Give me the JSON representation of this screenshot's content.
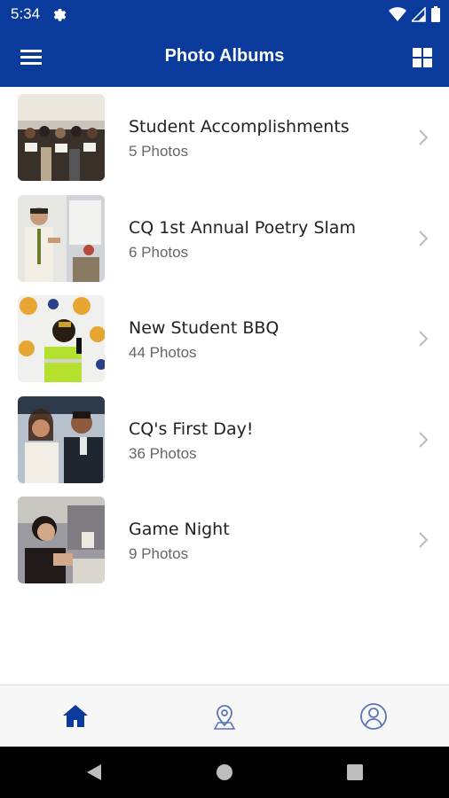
{
  "status_bar": {
    "time": "5:34",
    "icons": [
      "settings-icon",
      "wifi-icon",
      "signal-icon",
      "battery-icon"
    ]
  },
  "app_bar": {
    "title": "Photo Albums",
    "left_icon": "menu-icon",
    "right_icon": "grid-view-icon"
  },
  "albums": [
    {
      "title": "Student Accomplishments",
      "count": "5 Photos"
    },
    {
      "title": "CQ 1st Annual Poetry Slam",
      "count": "6 Photos"
    },
    {
      "title": "New Student BBQ",
      "count": "44 Photos"
    },
    {
      "title": "CQ's First Day!",
      "count": "36 Photos"
    },
    {
      "title": "Game Night",
      "count": "9 Photos"
    }
  ],
  "bottom_nav": {
    "items": [
      "home-icon",
      "location-icon",
      "profile-icon"
    ],
    "active": "home-icon"
  },
  "colors": {
    "brand": "#0a3b9c",
    "nav_active": "#0a3b9c",
    "nav_inactive": "#5a76b8"
  }
}
